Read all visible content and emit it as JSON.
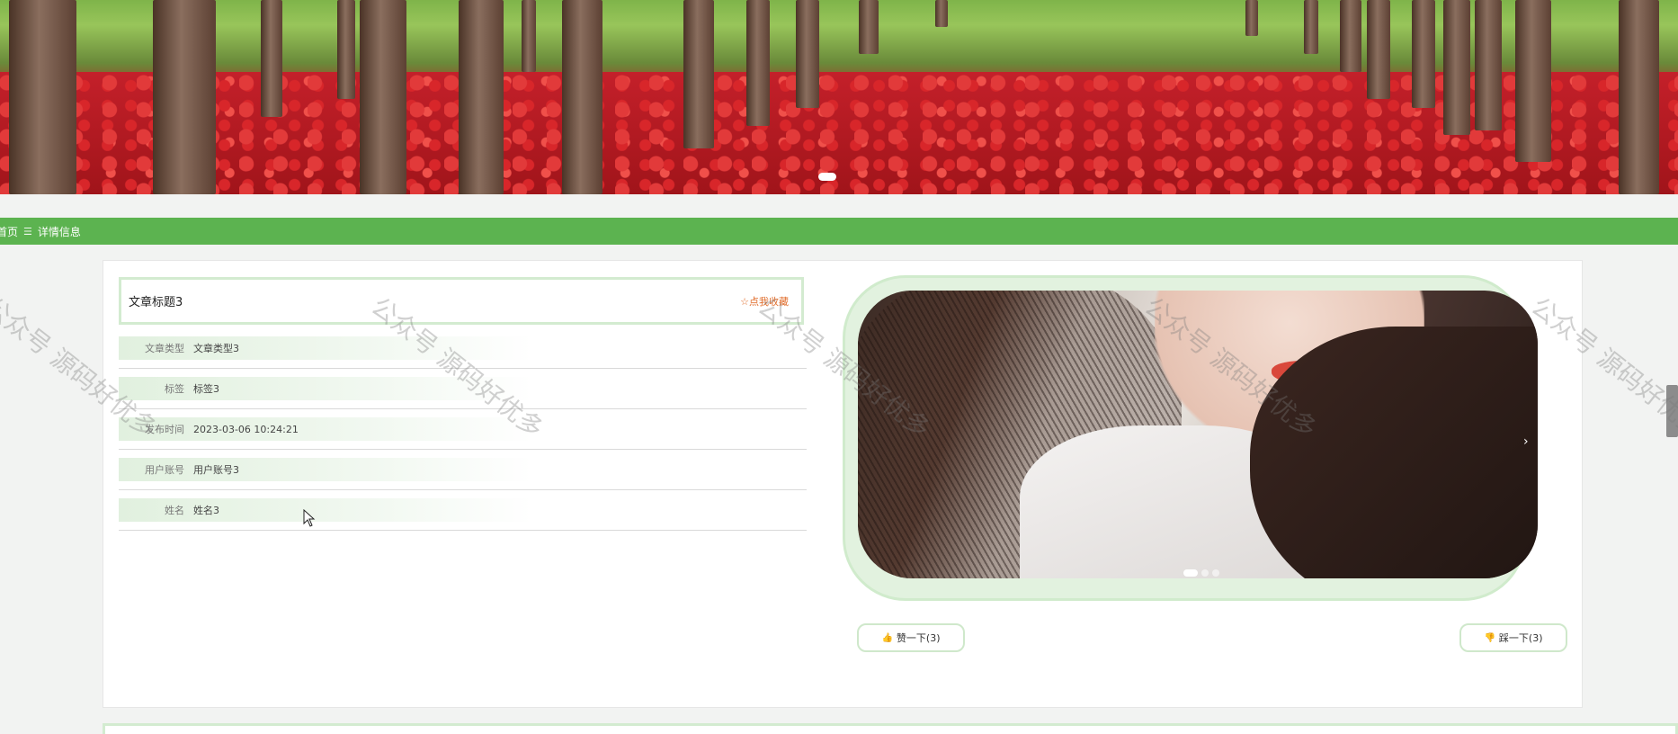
{
  "breadcrumb": {
    "home": "首页",
    "separator": "☰",
    "current": "详情信息"
  },
  "article": {
    "title": "文章标题3",
    "collect_label": "☆点我收藏"
  },
  "fields": [
    {
      "label": "文章类型",
      "value": "文章类型3"
    },
    {
      "label": "标签",
      "value": "标签3"
    },
    {
      "label": "发布时间",
      "value": "2023-03-06 10:24:21"
    },
    {
      "label": "用户账号",
      "value": "用户账号3"
    },
    {
      "label": "姓名",
      "value": "姓名3"
    }
  ],
  "votes": {
    "like_label": "赞一下(3)",
    "dislike_label": "踩一下(3)"
  },
  "carousel": {
    "next_symbol": "›",
    "slide_count": 3,
    "active_slide": 1
  },
  "watermark": "公众号 源码好优多",
  "theme": {
    "accent": "#5cb350",
    "collect_color": "#e06c2a"
  }
}
